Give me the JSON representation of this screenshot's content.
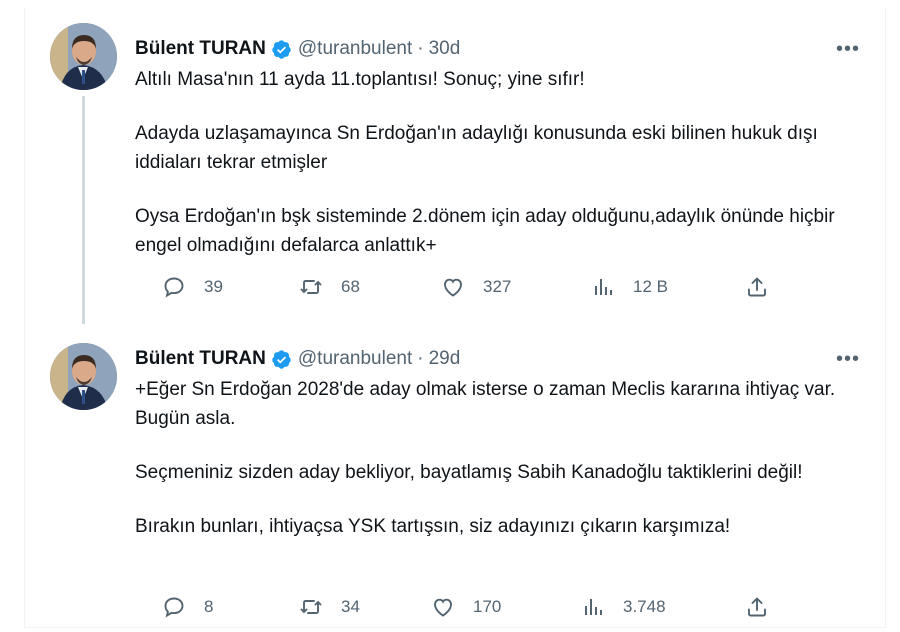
{
  "tweets": [
    {
      "name": "Bülent TURAN",
      "handle": "@turanbulent",
      "separator": "·",
      "time": "30d",
      "more": "•••",
      "paragraphs": [
        "Altılı Masa'nın 11 ayda 11.toplantısı! Sonuç; yine sıfır!",
        "Adayda uzlaşamayınca Sn Erdoğan'ın adaylığı konusunda eski bilinen hukuk dışı iddiaları tekrar etmişler",
        "Oysa Erdoğan'ın bşk sisteminde 2.dönem için aday olduğunu,adaylık önünde hiçbir engel olmadığını defalarca anlattık+"
      ],
      "replies": "39",
      "retweets": "68",
      "likes": "327",
      "views": "12 B"
    },
    {
      "name": "Bülent TURAN",
      "handle": "@turanbulent",
      "separator": "·",
      "time": "29d",
      "more": "•••",
      "paragraphs": [
        "+Eğer Sn Erdoğan 2028'de aday olmak isterse o zaman Meclis kararına ihtiyaç var. Bugün asla.",
        "Seçmeniniz sizden aday bekliyor, bayatlamış Sabih Kanadoğlu taktiklerini değil!",
        "Bırakın bunları, ihtiyaçsa YSK tartışsın, siz adayınızı çıkarın karşımıza!"
      ],
      "replies": "8",
      "retweets": "34",
      "likes": "170",
      "views": "3.748"
    }
  ],
  "colors": {
    "text": "#0f1419",
    "secondary": "#536471",
    "verified": "#1d9bf0",
    "thread_line": "#cfd9de"
  },
  "icons": [
    "reply-icon",
    "retweet-icon",
    "like-icon",
    "views-icon",
    "share-icon",
    "verified-badge-icon",
    "more-icon"
  ]
}
